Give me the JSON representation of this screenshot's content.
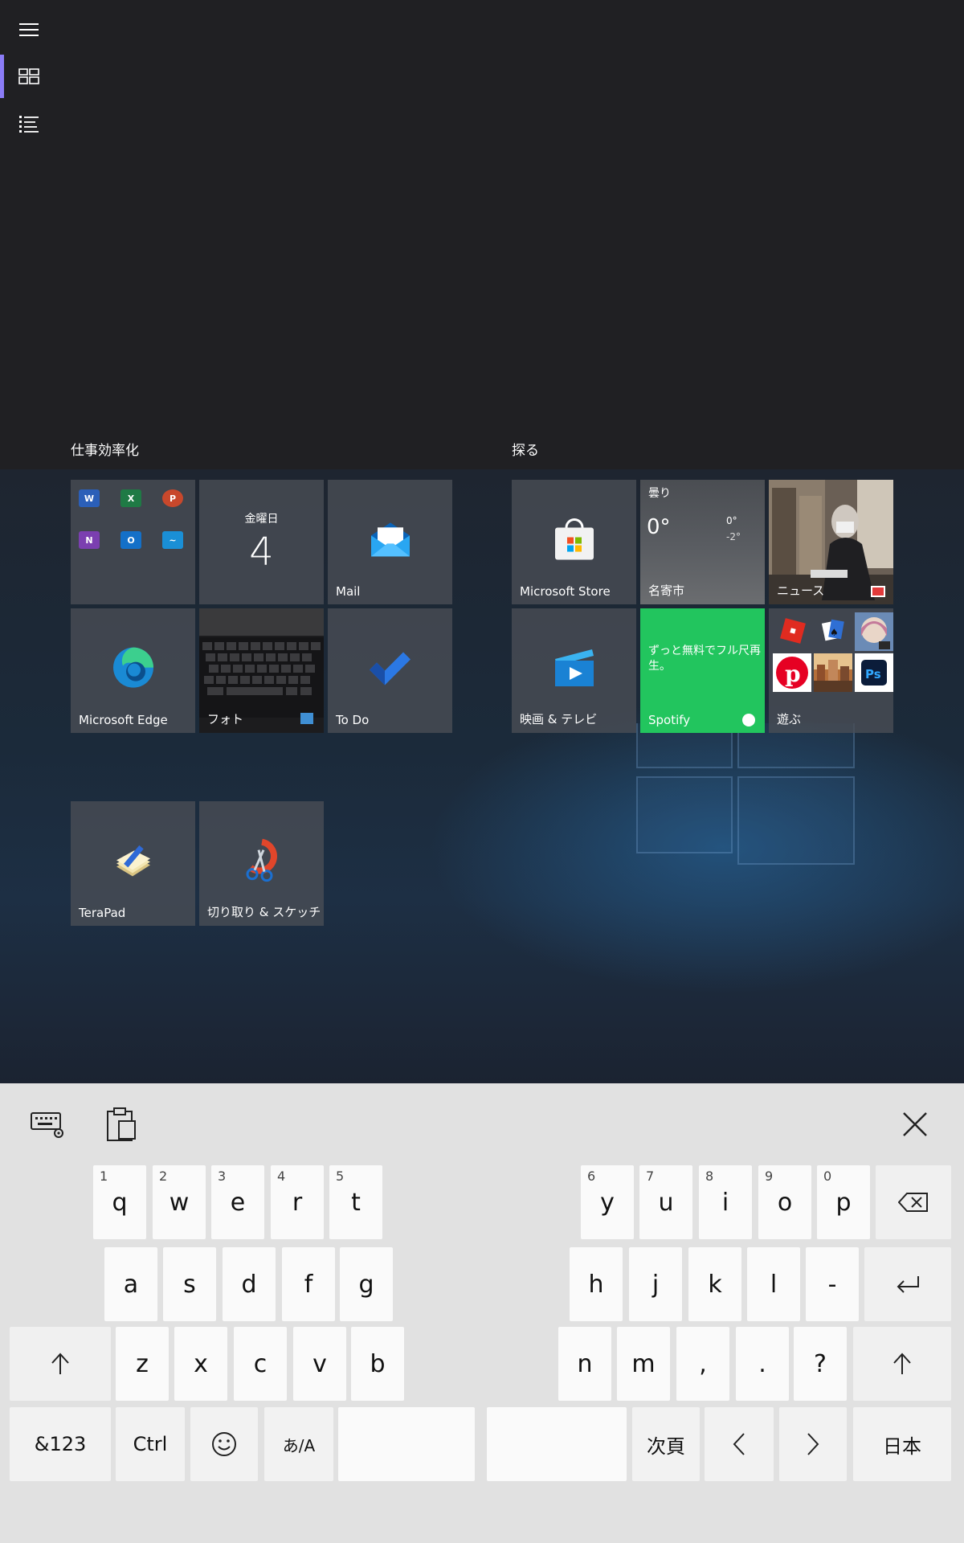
{
  "start": {
    "groups": [
      {
        "title": "仕事効率化"
      },
      {
        "title": "探る"
      }
    ],
    "tiles": {
      "office_apps": [
        "W",
        "X",
        "P",
        "N",
        "O",
        "~"
      ],
      "calendar": {
        "day": "金曜日",
        "date": "4"
      },
      "mail": {
        "label": "Mail"
      },
      "edge": {
        "label": "Microsoft Edge"
      },
      "photos": {
        "label": "フォト"
      },
      "todo": {
        "label": "To Do"
      },
      "terapad": {
        "label": "TeraPad"
      },
      "snip": {
        "label": "切り取り & スケッチ"
      },
      "store": {
        "label": "Microsoft Store"
      },
      "weather": {
        "condition": "曇り",
        "temp": "0°",
        "high": "0°",
        "low": "-2°",
        "city": "名寄市"
      },
      "news": {
        "label": "ニュース"
      },
      "movies": {
        "label": "映画 & テレビ"
      },
      "spotify": {
        "text": "ずっと無料でフル尺再生。",
        "label": "Spotify"
      },
      "play": {
        "label": "遊ぶ",
        "ps_text": "Ps"
      }
    }
  },
  "keyboard": {
    "row1_left": [
      {
        "hint": "1",
        "label": "q"
      },
      {
        "hint": "2",
        "label": "w"
      },
      {
        "hint": "3",
        "label": "e"
      },
      {
        "hint": "4",
        "label": "r"
      },
      {
        "hint": "5",
        "label": "t"
      }
    ],
    "row1_right": [
      {
        "hint": "6",
        "label": "y"
      },
      {
        "hint": "7",
        "label": "u"
      },
      {
        "hint": "8",
        "label": "i"
      },
      {
        "hint": "9",
        "label": "o"
      },
      {
        "hint": "0",
        "label": "p"
      }
    ],
    "row2_left": [
      "a",
      "s",
      "d",
      "f",
      "g"
    ],
    "row2_right": [
      "h",
      "j",
      "k",
      "l",
      "-"
    ],
    "row3_left": [
      "z",
      "x",
      "c",
      "v",
      "b"
    ],
    "row3_right": [
      "n",
      "m",
      ",",
      ".",
      "?"
    ],
    "numbers_label": "&123",
    "ctrl_label": "Ctrl",
    "ime_label": "あ/A",
    "next_page_label": "次頁",
    "language_label": "日本"
  },
  "colors": {
    "accent": "#8b7cf7",
    "spotify": "#22c55e",
    "word": "#2b5fb8",
    "excel": "#1f7a45",
    "powerpoint": "#c8482c",
    "onenote": "#7b3fb0",
    "outlook": "#1470c8",
    "sway": "#1a8fd6"
  }
}
